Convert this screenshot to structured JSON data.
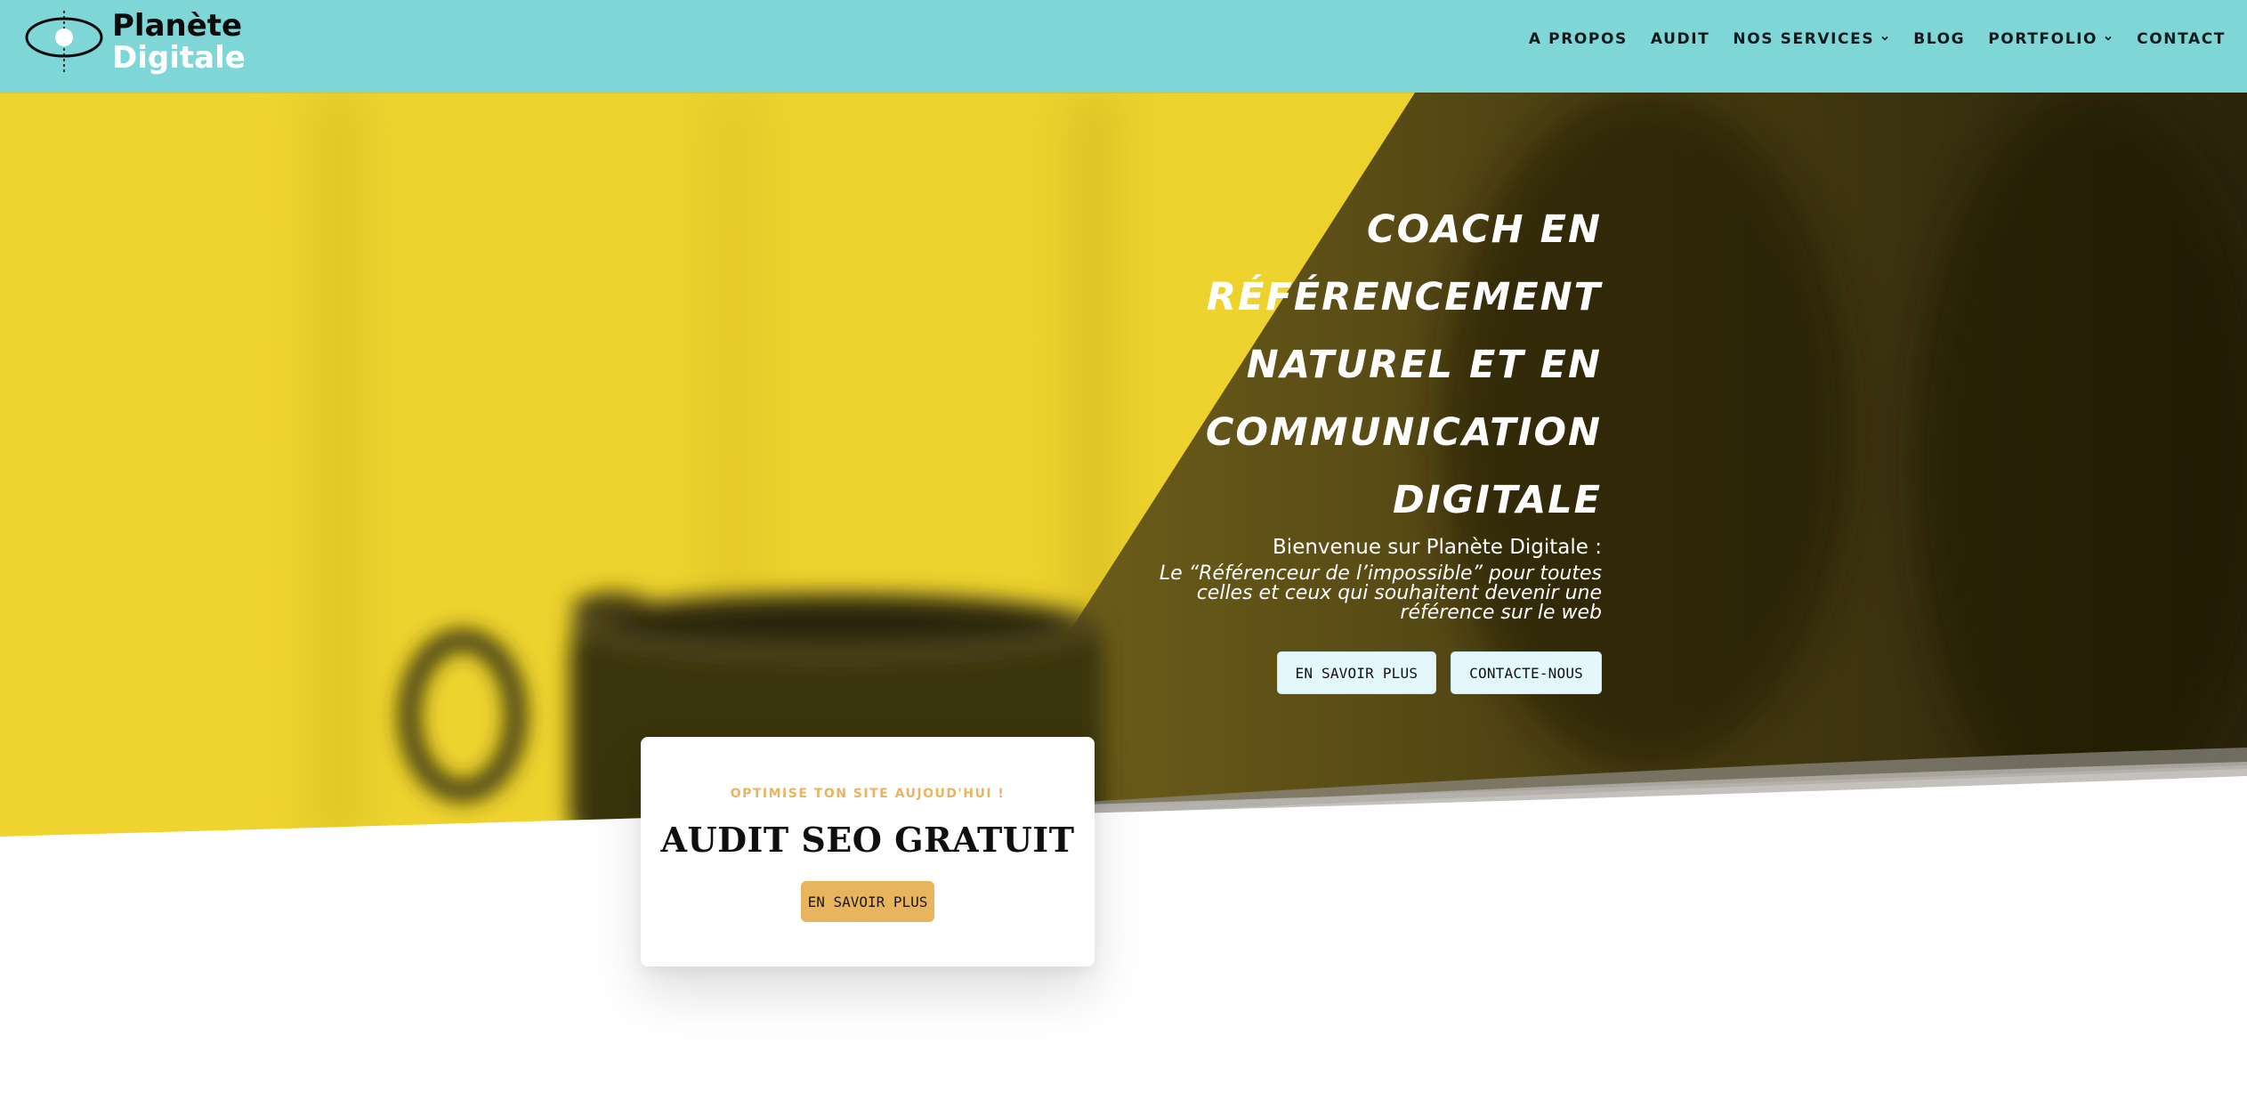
{
  "brand": {
    "name_line1": "Planète",
    "name_line2": "Digitale",
    "logo_icon": "eye-orbit-logo"
  },
  "nav": {
    "items": [
      {
        "label": "A PROPOS",
        "has_dropdown": false
      },
      {
        "label": "AUDIT",
        "has_dropdown": false
      },
      {
        "label": "NOS SERVICES",
        "has_dropdown": true
      },
      {
        "label": "BLOG",
        "has_dropdown": false
      },
      {
        "label": "PORTFOLIO",
        "has_dropdown": true
      },
      {
        "label": "CONTACT",
        "has_dropdown": false
      }
    ],
    "dropdown_icon": "chevron-down-icon"
  },
  "hero": {
    "title_lines": [
      "COACH EN",
      "RÉFÉRENCEMENT",
      "NATUREL ET EN",
      "COMMUNICATION",
      "DIGITALE"
    ],
    "welcome": "Bienvenue sur Planète Digitale :",
    "tagline": "Le “Référenceur de l’impossible” pour toutes celles et ceux qui souhaitent devenir une référence sur le web",
    "buttons": {
      "primary": "EN SAVOIR PLUS",
      "secondary": "CONTACTE-NOUS"
    }
  },
  "audit_card": {
    "eyebrow": "OPTIMISE TON SITE AUJOUD'HUI !",
    "title": "AUDIT SEO GRATUIT",
    "button": "EN SAVOIR PLUS"
  },
  "colors": {
    "header_bg": "#7fd6d7",
    "hero_yellow": "#efd32f",
    "hero_dark": "#26210a",
    "accent_orange": "#e8b45e",
    "button_light": "#e4f7fd"
  }
}
